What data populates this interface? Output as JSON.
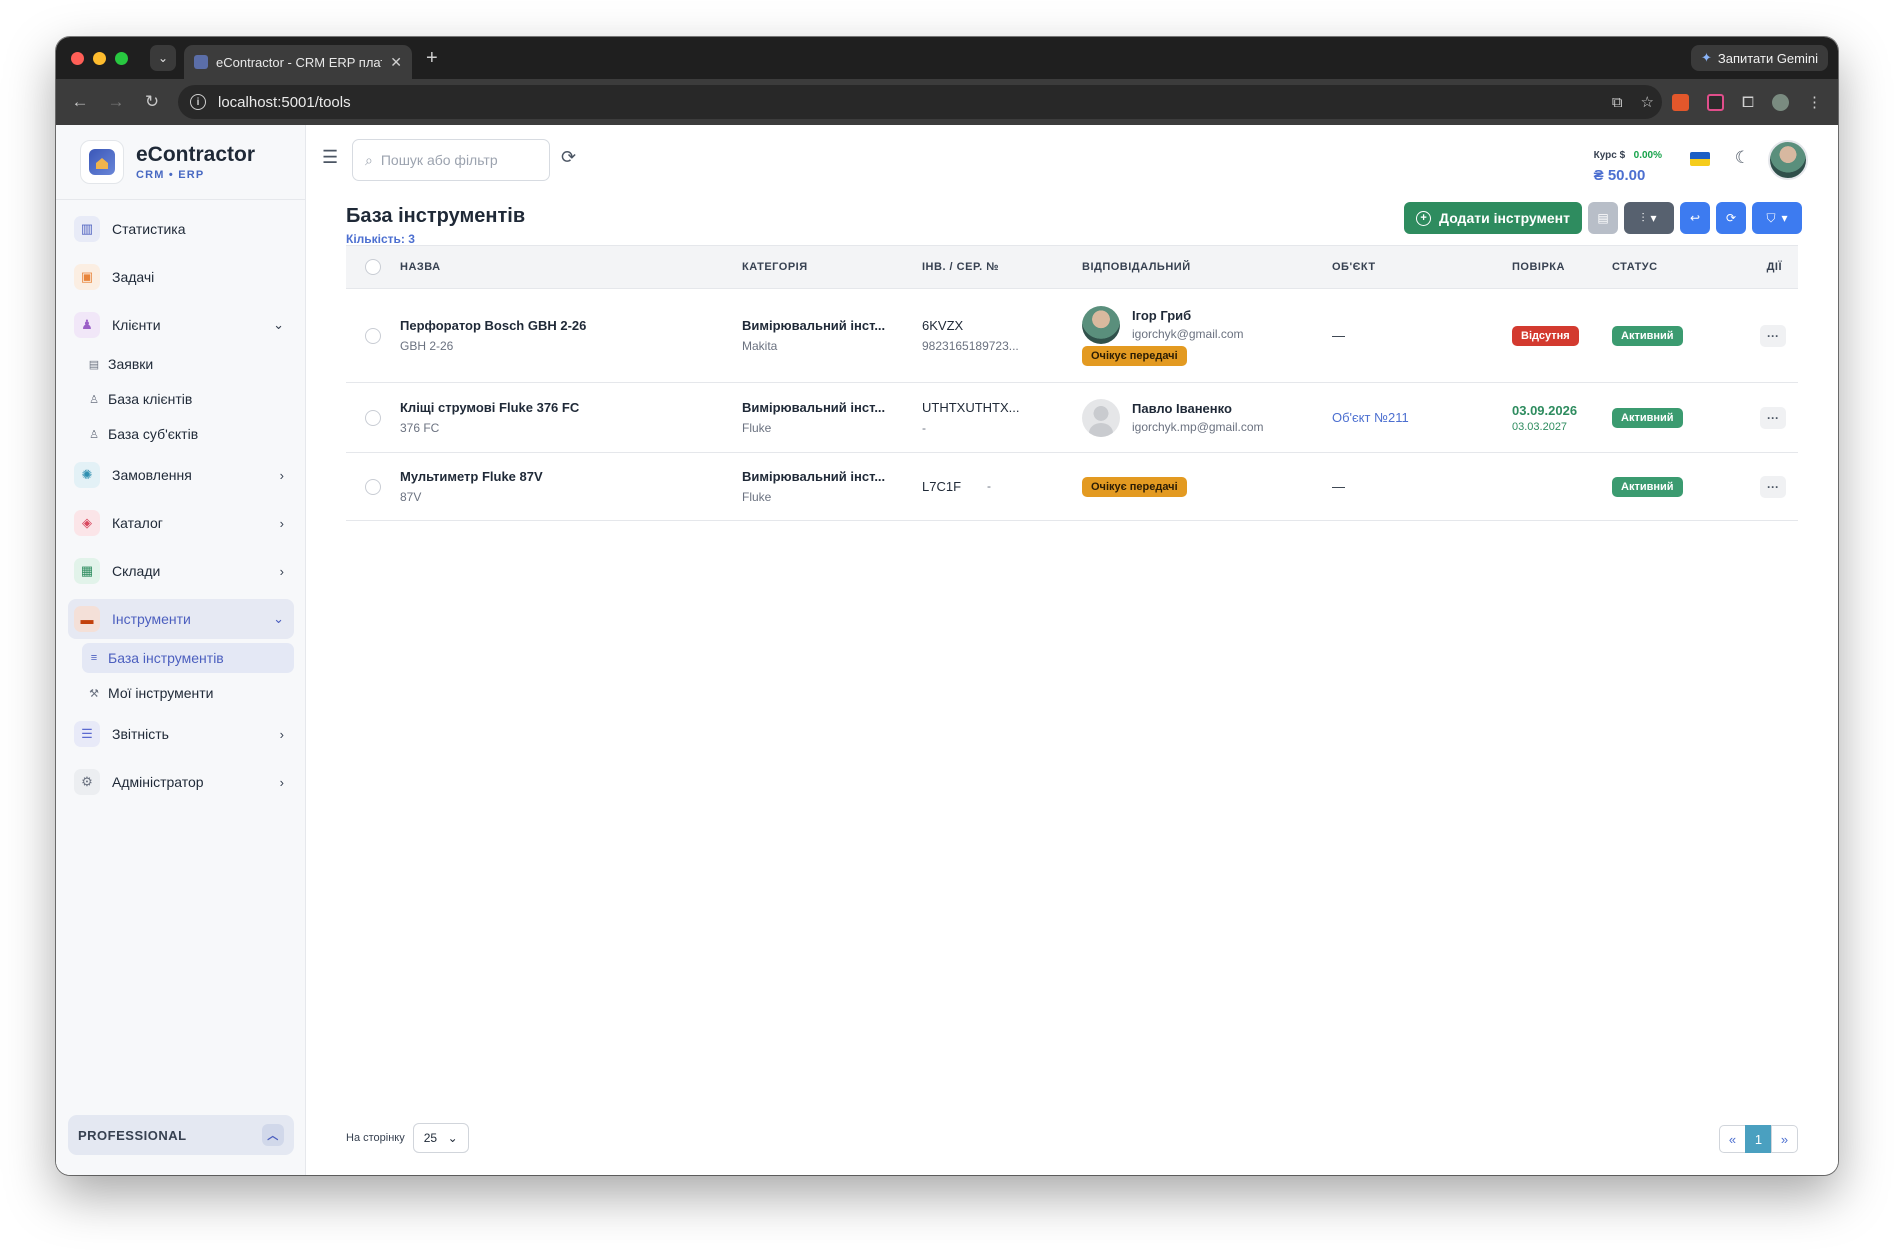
{
  "browser": {
    "tab_title": "eContractor - CRM ERP плат",
    "tab_close": "✕",
    "new_tab": "+",
    "gemini_label": "Запитати Gemini",
    "url": "localhost:5001/tools"
  },
  "brand": {
    "name": "eContractor",
    "sub": "CRM • ERP"
  },
  "sidebar": {
    "items": [
      {
        "label": "Статистика",
        "icon": "bar-chart-icon",
        "color": "#4c5fbf"
      },
      {
        "label": "Задачі",
        "icon": "clipboard-icon",
        "color": "#e8843a"
      },
      {
        "label": "Клієнти",
        "icon": "users-icon",
        "color": "#9b5fc7"
      },
      {
        "label": "Замовлення",
        "icon": "orders-icon",
        "color": "#2f8fb0"
      },
      {
        "label": "Каталог",
        "icon": "box-icon",
        "color": "#d9485f"
      },
      {
        "label": "Склади",
        "icon": "warehouse-icon",
        "color": "#2e8c5f"
      },
      {
        "label": "Інструменти",
        "icon": "toolbox-icon",
        "color": "#c2410c"
      },
      {
        "label": "Звітність",
        "icon": "report-icon",
        "color": "#5b6ad0"
      },
      {
        "label": "Адміністратор",
        "icon": "gear-icon",
        "color": "#6b7280"
      }
    ],
    "clients_sub": [
      {
        "label": "Заявки"
      },
      {
        "label": "База клієнтів"
      },
      {
        "label": "База суб'єктів"
      }
    ],
    "tools_sub": [
      {
        "label": "База інструментів"
      },
      {
        "label": "Мої інструменти"
      }
    ],
    "plan": "PROFESSIONAL"
  },
  "header": {
    "search_placeholder": "Пошук або фільтр",
    "rate_label": "Курс $",
    "rate_change": "0.00%",
    "rate_value": "₴ 50.00"
  },
  "page": {
    "title": "База інструментів",
    "count": "Кількість: 3",
    "add_button": "Додати інструмент"
  },
  "table": {
    "columns": [
      "НАЗВА",
      "КАТЕГОРІЯ",
      "ІНВ. / СЕР. №",
      "ВІДПОВІДАЛЬНИЙ",
      "ОБ'ЄКТ",
      "ПОВІРКА",
      "СТАТУС",
      "ДІЇ"
    ],
    "rows": [
      {
        "name": "Перфоратор Bosch GBH 2-26",
        "model": "GBH 2-26",
        "category": "Вимірювальний інст...",
        "brand": "Makita",
        "inv": "6KVZX",
        "serial": "9823165189723...",
        "resp_name": "Ігор Гриб",
        "resp_email": "igorchyk@gmail.com",
        "resp_badge": "Очікує передачі",
        "object": "—",
        "check_badge": "Відсутня",
        "status": "Активний"
      },
      {
        "name": "Кліщі струмові Fluke 376 FC",
        "model": "376 FC",
        "category": "Вимірювальний інст...",
        "brand": "Fluke",
        "inv": "UTHTXUTHTX...",
        "serial": "-",
        "resp_name": "Павло Іваненко",
        "resp_email": "igorchyk.mp@gmail.com",
        "object": "Об'єкт №211",
        "check_date": "03.09.2026",
        "check_next": "03.03.2027",
        "status": "Активний"
      },
      {
        "name": "Мультиметр Fluke 87V",
        "model": "87V",
        "category": "Вимірювальний інст...",
        "brand": "Fluke",
        "inv": "L7C1F",
        "serial": "-",
        "resp_badge": "Очікує передачі",
        "object": "—",
        "status": "Активний"
      }
    ],
    "actions_label": "···"
  },
  "footer": {
    "per_page_label": "На сторінку",
    "per_page_value": "25",
    "prev": "«",
    "page": "1",
    "next": "»"
  }
}
